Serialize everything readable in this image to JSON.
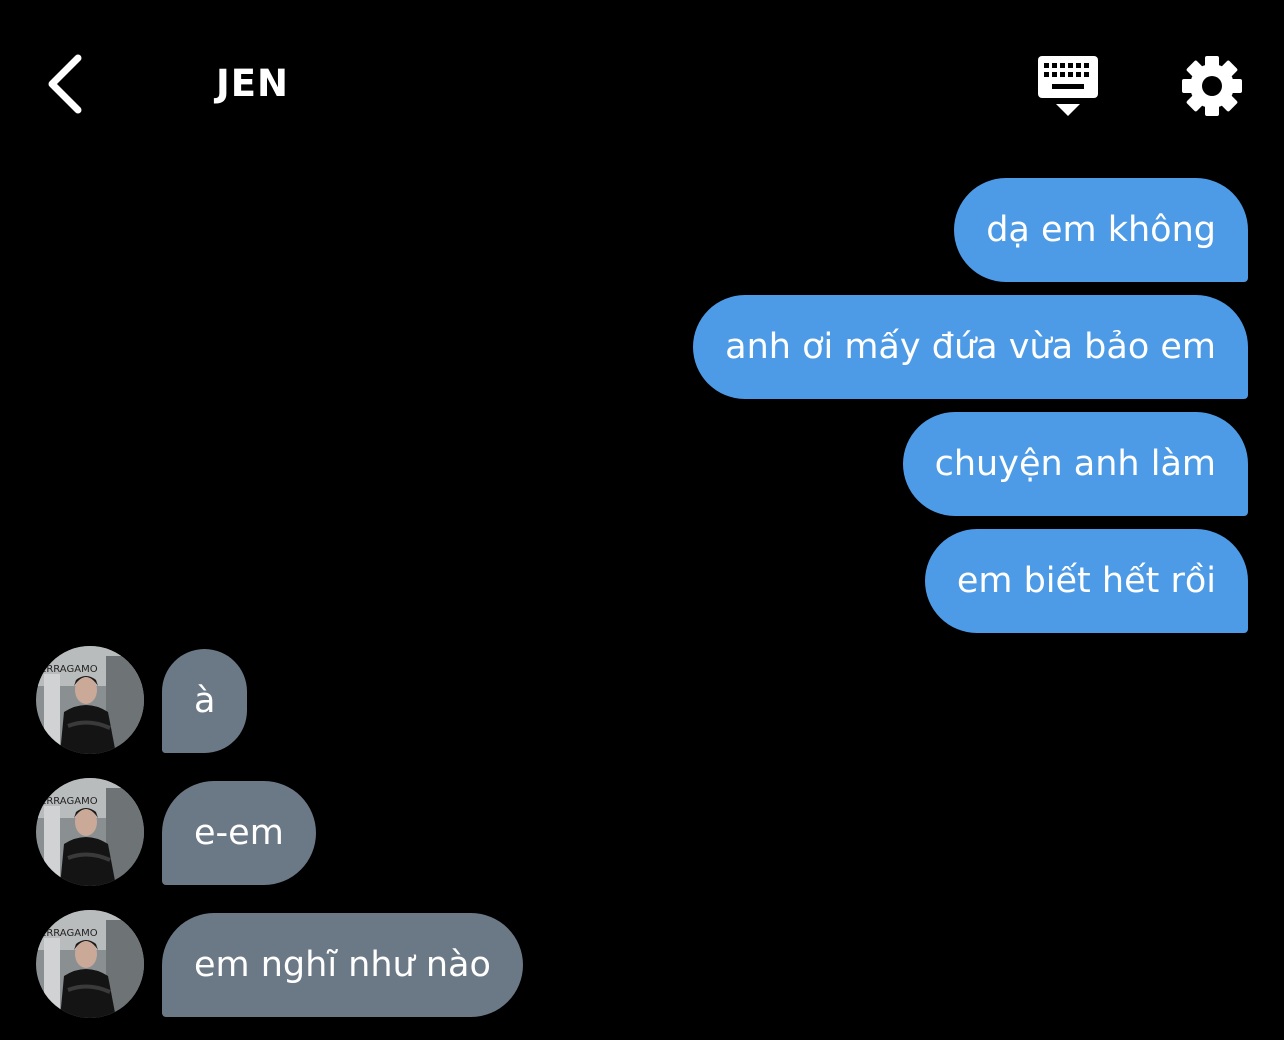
{
  "header": {
    "title": "JEN",
    "back_icon": "chevron-left-icon",
    "keyboard_icon": "keyboard-icon",
    "settings_icon": "gear-icon"
  },
  "colors": {
    "background": "#000000",
    "sent_bubble": "#4d9be6",
    "received_bubble": "#6b7886",
    "text": "#ffffff"
  },
  "messages": {
    "sent": [
      {
        "text": "dạ em không"
      },
      {
        "text": "anh ơi mấy đứa vừa bảo em"
      },
      {
        "text": "chuyện anh làm"
      },
      {
        "text": "em biết hết rồi"
      }
    ],
    "received": [
      {
        "text": "à",
        "avatar_text": "ERRAGAMO"
      },
      {
        "text": "e-em",
        "avatar_text": "ERRAGAMO"
      },
      {
        "text": "em nghĩ như nào",
        "avatar_text": "ERRAGAMO"
      }
    ]
  }
}
